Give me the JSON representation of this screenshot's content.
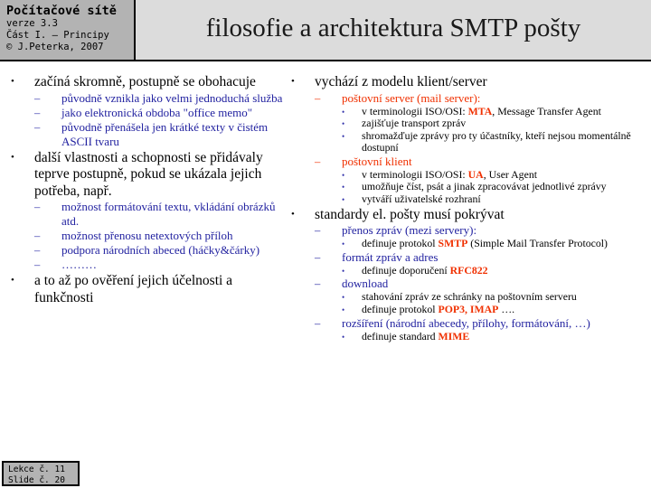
{
  "header": {
    "logo_title": "Počítačové sítě",
    "logo_version": "verze 3.3",
    "logo_part": "Část I. – Principy",
    "logo_copyright": "© J.Peterka,  2007",
    "slide_title": "filosofie a architektura SMTP pošty"
  },
  "colors": {
    "header_logo_bg": "#b3b3b3",
    "header_title_bg": "#dcdcdc",
    "level1_text": "#000000",
    "level2_text": "#2222a0",
    "level3_text": "#000000",
    "highlight": "#f03000"
  },
  "bullets": {
    "level1": "•",
    "level2": "–",
    "level3": "•"
  },
  "left_column": [
    {
      "text": "začíná skromně, postupně se obohacuje",
      "children": [
        {
          "text": "původně vznikla jako velmi jednoduchá služba"
        },
        {
          "text": "jako elektronická obdoba  \"office memo\""
        },
        {
          "text": "původně přenášela jen krátké texty v čistém ASCII tvaru"
        }
      ]
    },
    {
      "text": "další vlastnosti a schopnosti se přidávaly teprve postupně, pokud se ukázala jejich potřeba, např.",
      "children": [
        {
          "text": "možnost formátování textu, vkládání obrázků atd."
        },
        {
          "text": "možnost přenosu netextových příloh"
        },
        {
          "text": "podpora národních abeced (háčky&čárky)"
        },
        {
          "text": "………"
        }
      ]
    },
    {
      "text": "a to až po ověření jejich účelnosti a funkčnosti",
      "children": []
    }
  ],
  "right_column": [
    {
      "text": "vychází z modelu klient/server",
      "children": [
        {
          "text": "poštovní server (mail server):",
          "color": "#f03000",
          "children": [
            {
              "pre": "v terminologii ISO/OSI: ",
              "hl": "MTA",
              "post": ", Message Transfer Agent"
            },
            {
              "pre": "zajišťuje transport zpráv",
              "hl": "",
              "post": ""
            },
            {
              "pre": "shromažďuje zprávy pro ty účastníky, kteří nejsou momentálně dostupní",
              "hl": "",
              "post": ""
            }
          ]
        },
        {
          "text": "poštovní klient",
          "color": "#f03000",
          "children": [
            {
              "pre": "v terminologii ISO/OSI: ",
              "hl": "UA",
              "post": ", User Agent"
            },
            {
              "pre": "umožňuje číst, psát a jinak zpracovávat jednotlivé zprávy",
              "hl": "",
              "post": ""
            },
            {
              "pre": "vytváří uživatelské rozhraní",
              "hl": "",
              "post": ""
            }
          ]
        }
      ]
    },
    {
      "text": "standardy el. pošty musí pokrývat",
      "children": [
        {
          "text": "přenos zpráv (mezi servery):",
          "color": "#2222a0",
          "children": [
            {
              "pre": "definuje protokol ",
              "hl": "SMTP",
              "post": " (Simple Mail Transfer Protocol)"
            }
          ]
        },
        {
          "text": "formát zpráv a adres",
          "color": "#2222a0",
          "children": [
            {
              "pre": "definuje doporučení ",
              "hl": "RFC822",
              "post": ""
            }
          ]
        },
        {
          "text": "download",
          "color": "#2222a0",
          "children": [
            {
              "pre": "stahování zpráv ze schránky na poštovním serveru",
              "hl": "",
              "post": ""
            },
            {
              "pre": "definuje protokol ",
              "hl": "POP3, IMAP",
              "post": " …."
            }
          ]
        },
        {
          "text": "rozšíření (národní abecedy, přílohy, formátování, …)",
          "color": "#2222a0",
          "children": [
            {
              "pre": "definuje standard ",
              "hl": "MIME",
              "post": ""
            }
          ]
        }
      ]
    }
  ],
  "footer": {
    "lecture": "Lekce č. 11",
    "slide": "Slide č. 20"
  }
}
